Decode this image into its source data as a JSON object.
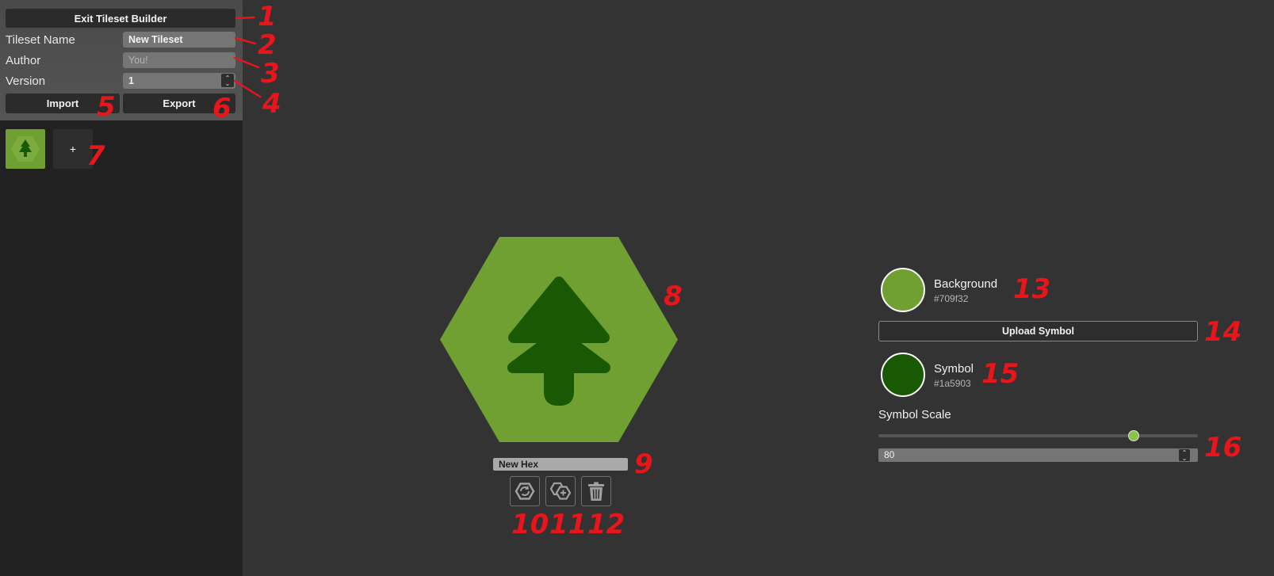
{
  "sidebar": {
    "exit_button": "Exit Tileset Builder",
    "tileset_name_label": "Tileset Name",
    "tileset_name_value": "New Tileset",
    "author_label": "Author",
    "author_placeholder": "You!",
    "version_label": "Version",
    "version_value": "1",
    "import_button": "Import",
    "export_button": "Export",
    "add_tile_label": "+"
  },
  "editor": {
    "hex_name": "New Hex",
    "actions": [
      {
        "icon": "hex-replace-icon"
      },
      {
        "icon": "hex-duplicate-icon"
      },
      {
        "icon": "trash-icon"
      }
    ]
  },
  "properties": {
    "background_label": "Background",
    "background_color": "#709f32",
    "upload_symbol_button": "Upload Symbol",
    "symbol_label": "Symbol",
    "symbol_color": "#1a5903",
    "symbol_scale_label": "Symbol Scale",
    "symbol_scale_value": "80",
    "symbol_scale_percent": 80
  },
  "colors": {
    "accent_slider": "#8bc34a",
    "annotation": "#e8151b"
  },
  "annotations": [
    "1",
    "2",
    "3",
    "4",
    "5",
    "6",
    "7",
    "8",
    "9",
    "10",
    "11",
    "12",
    "13",
    "14",
    "15",
    "16"
  ]
}
